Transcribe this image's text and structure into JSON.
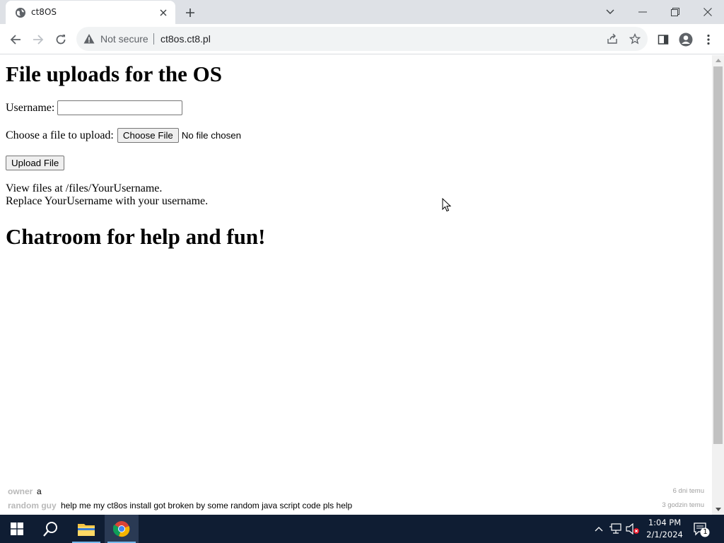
{
  "browser": {
    "tab_title": "ct8OS",
    "address_warning": "Not secure",
    "url": "ct8os.ct8.pl"
  },
  "page": {
    "heading": "File uploads for the OS",
    "username_label": "Username:",
    "username_value": "",
    "file_label": "Choose a file to upload:",
    "choose_file_button": "Choose File",
    "no_file_text": "No file chosen",
    "upload_button": "Upload File",
    "info_line1": "View files at /files/YourUsername.",
    "info_line2": "Replace YourUsername with your username.",
    "chat_heading": "Chatroom for help and fun!"
  },
  "chat": {
    "messages": [
      {
        "user": "owner",
        "text": "a",
        "time": "6 dni temu"
      },
      {
        "user": "random guy",
        "text": "help me my ct8os install got broken by some random java script code pls help",
        "time": "3 godzin temu"
      }
    ]
  },
  "taskbar": {
    "time": "1:04 PM",
    "date": "2/1/2024",
    "notification_count": "1"
  },
  "colors": {
    "titlebar_bg": "#dee1e6",
    "taskbar_bg": "#0f1d33",
    "chat_user": "#b9b9b9",
    "chat_time": "#a0a0a0"
  }
}
